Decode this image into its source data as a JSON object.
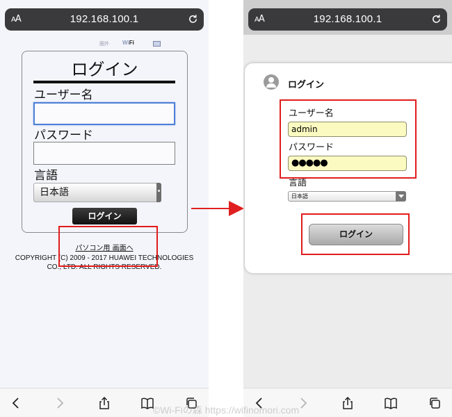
{
  "browser": {
    "text_size_label": "AA",
    "url": "192.168.100.1"
  },
  "left_page": {
    "top_icons": {
      "outside_label": "圏外",
      "wifi_label": "Wi",
      "wifi_label_bold": "Fi"
    },
    "title": "ログイン",
    "username_label": "ユーザー名",
    "username_value": "",
    "password_label": "パスワード",
    "password_value": "",
    "language_label": "言語",
    "language_selected": "日本語",
    "login_button": "ログイン",
    "pc_view_link": "パソコン用 画面へ",
    "copyright_line1": "COPYRIGHT (C) 2009 - 2017 HUAWEI TECHNOLOGIES",
    "copyright_line2": "CO., LTD. ALL RIGHTS RESERVED."
  },
  "right_page": {
    "title": "ログイン",
    "username_label": "ユーザー名",
    "username_value": "admin",
    "password_label": "パスワード",
    "password_mask": "●●●●●",
    "language_label": "言語",
    "language_selected": "日本語",
    "login_button": "ログイン"
  },
  "toolbar_icons": [
    "back-icon",
    "forward-icon",
    "share-icon",
    "bookmarks-icon",
    "tabs-icon"
  ],
  "colors": {
    "highlight": "#e11b1b",
    "arrow": "#e02020",
    "autofill": "#fbfbc1"
  },
  "watermark": "©Wi-Fiの森 https://wifinomori.com"
}
